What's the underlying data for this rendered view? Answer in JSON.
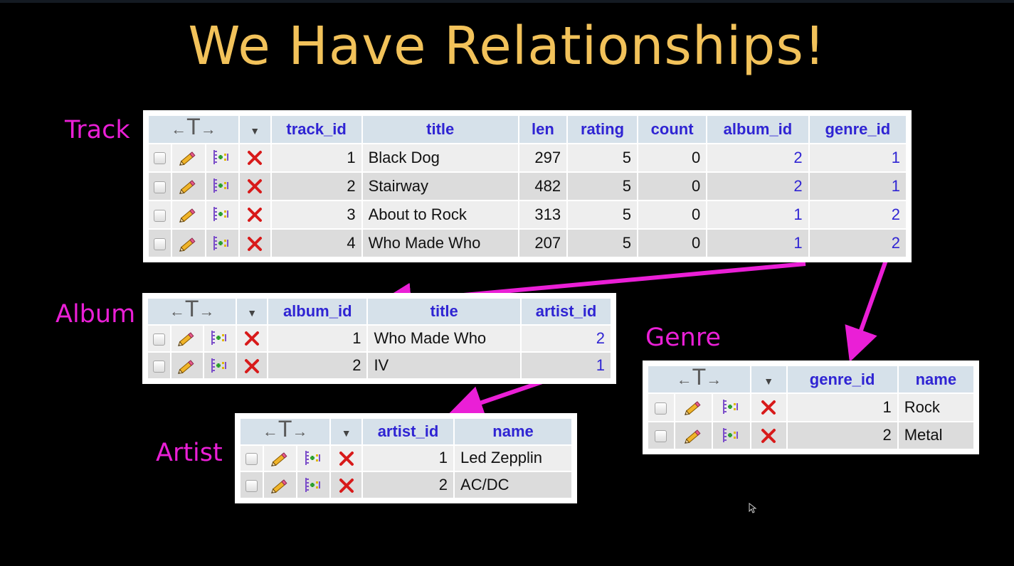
{
  "slide": {
    "title": "We Have Relationships!"
  },
  "colors": {
    "background": "#000000",
    "title": "#f2c25a",
    "table_label": "#ea1fd6",
    "arrow": "#ea1fd6",
    "header_text": "#2f24d3",
    "header_bg": "#d6e1ea"
  },
  "icons": {
    "sort_control": "←T→",
    "dropdown": "▼",
    "edit": "pencil-icon",
    "copy": "copy-row-icon",
    "delete": "delete-x-icon"
  },
  "track": {
    "label": "Track",
    "columns": [
      "track_id",
      "title",
      "len",
      "rating",
      "count",
      "album_id",
      "genre_id"
    ],
    "rows": [
      [
        "1",
        "Black Dog",
        "297",
        "5",
        "0",
        "2",
        "1"
      ],
      [
        "2",
        "Stairway",
        "482",
        "5",
        "0",
        "2",
        "1"
      ],
      [
        "3",
        "About to Rock",
        "313",
        "5",
        "0",
        "1",
        "2"
      ],
      [
        "4",
        "Who Made Who",
        "207",
        "5",
        "0",
        "1",
        "2"
      ]
    ]
  },
  "album": {
    "label": "Album",
    "columns": [
      "album_id",
      "title",
      "artist_id"
    ],
    "rows": [
      [
        "1",
        "Who Made Who",
        "2"
      ],
      [
        "2",
        "IV",
        "1"
      ]
    ]
  },
  "artist": {
    "label": "Artist",
    "columns": [
      "artist_id",
      "name"
    ],
    "rows": [
      [
        "1",
        "Led Zepplin"
      ],
      [
        "2",
        "AC/DC"
      ]
    ]
  },
  "genre": {
    "label": "Genre",
    "columns": [
      "genre_id",
      "name"
    ],
    "rows": [
      [
        "1",
        "Rock"
      ],
      [
        "2",
        "Metal"
      ]
    ]
  }
}
